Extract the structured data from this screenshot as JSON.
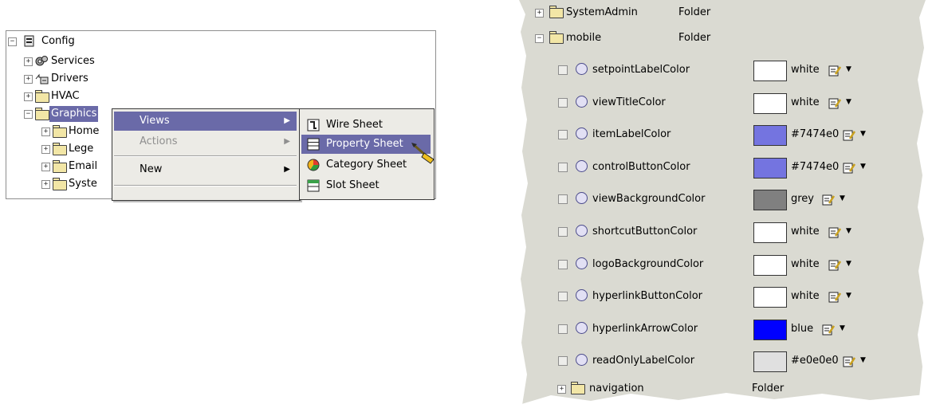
{
  "tree": {
    "root_label": "Config",
    "items": [
      {
        "label": "Services",
        "icon": "gears-icon"
      },
      {
        "label": "Drivers",
        "icon": "drivers-icon"
      },
      {
        "label": "HVAC",
        "icon": "folder-icon"
      },
      {
        "label": "Graphics",
        "icon": "folder-icon"
      }
    ],
    "children": [
      "Home",
      "Lege",
      "Email",
      "Syste"
    ]
  },
  "context_menu": {
    "items": [
      "Views",
      "Actions",
      "New"
    ]
  },
  "submenu": {
    "items": [
      "Wire Sheet",
      "Property Sheet",
      "Category Sheet",
      "Slot Sheet"
    ]
  },
  "property_sheet": {
    "top": {
      "name": "SystemAdmin",
      "type": "Folder"
    },
    "folder": {
      "name": "mobile",
      "type": "Folder"
    },
    "rows": [
      {
        "name": "setpointLabelColor",
        "value": "white",
        "color": "#ffffff"
      },
      {
        "name": "viewTitleColor",
        "value": "white",
        "color": "#ffffff"
      },
      {
        "name": "itemLabelColor",
        "value": "#7474e0",
        "color": "#7474e0"
      },
      {
        "name": "controlButtonColor",
        "value": "#7474e0",
        "color": "#7474e0"
      },
      {
        "name": "viewBackgroundColor",
        "value": "grey",
        "color": "#808080"
      },
      {
        "name": "shortcutButtonColor",
        "value": "white",
        "color": "#ffffff"
      },
      {
        "name": "logoBackgroundColor",
        "value": "white",
        "color": "#ffffff"
      },
      {
        "name": "hyperlinkButtonColor",
        "value": "white",
        "color": "#ffffff"
      },
      {
        "name": "hyperlinkArrowColor",
        "value": "blue",
        "color": "#0000ff"
      },
      {
        "name": "readOnlyLabelColor",
        "value": "#e0e0e0",
        "color": "#e0e0e0"
      }
    ],
    "bottom": {
      "name": "navigation",
      "type": "Folder"
    }
  },
  "colors": {
    "selection": "#6a6aa8",
    "menu_bg": "#ecebe6",
    "sheet_bg": "#dadad2"
  }
}
